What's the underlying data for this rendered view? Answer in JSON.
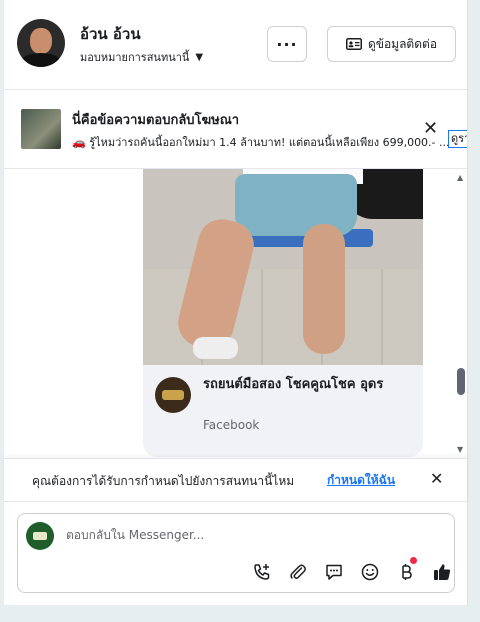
{
  "header": {
    "contact_name": "อ้วน อ้วน",
    "assign_label": "มอบหมายการสนทนานี้",
    "more_label": "···",
    "contact_info_label": "ดูข้อมูลติดต่อ"
  },
  "ad_banner": {
    "title": "นี่คือข้อความตอบกลับโฆษณา",
    "subtitle": "🚗 รู้ไหมว่ารถคันนี้ออกใหม่มา 1.4 ล้านบาท! แต่ตอนนี้เหลือเพียง 699,000.- ...",
    "close_label": "✕",
    "link_label": "ดูรา"
  },
  "message_card": {
    "page_name": "รถยนต์มือสอง โชคคูณโชค อุดร",
    "source": "Facebook"
  },
  "suggestion": {
    "text": "คุณต้องการได้รับการกำหนดไปยังการสนทนานี้ไหม",
    "link_label": "กำหนดให้ฉัน",
    "close_label": "✕"
  },
  "composer": {
    "placeholder": "ตอบกลับใน Messenger..."
  },
  "colors": {
    "accent": "#1877f2",
    "notification_dot": "#f0284a"
  }
}
